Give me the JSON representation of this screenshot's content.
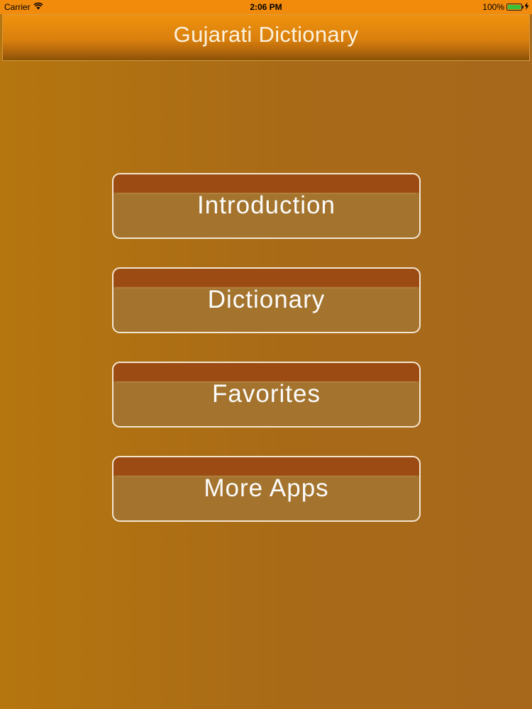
{
  "status_bar": {
    "carrier": "Carrier",
    "wifi_icon": "wifi-icon",
    "time": "2:06 PM",
    "battery_percent": "100%",
    "battery_level": 1.0,
    "charging_icon": "bolt-icon"
  },
  "nav": {
    "title": "Gujarati Dictionary"
  },
  "menu": {
    "items": [
      {
        "label": "Introduction"
      },
      {
        "label": "Dictionary"
      },
      {
        "label": "Favorites"
      },
      {
        "label": "More Apps"
      }
    ]
  },
  "colors": {
    "background": "#a86a17",
    "nav_bar": "#f0920f",
    "button_top": "#9c4c12",
    "button_body": "#a4742e",
    "button_border": "#f3e6d1",
    "battery_fill": "#38c23a"
  }
}
